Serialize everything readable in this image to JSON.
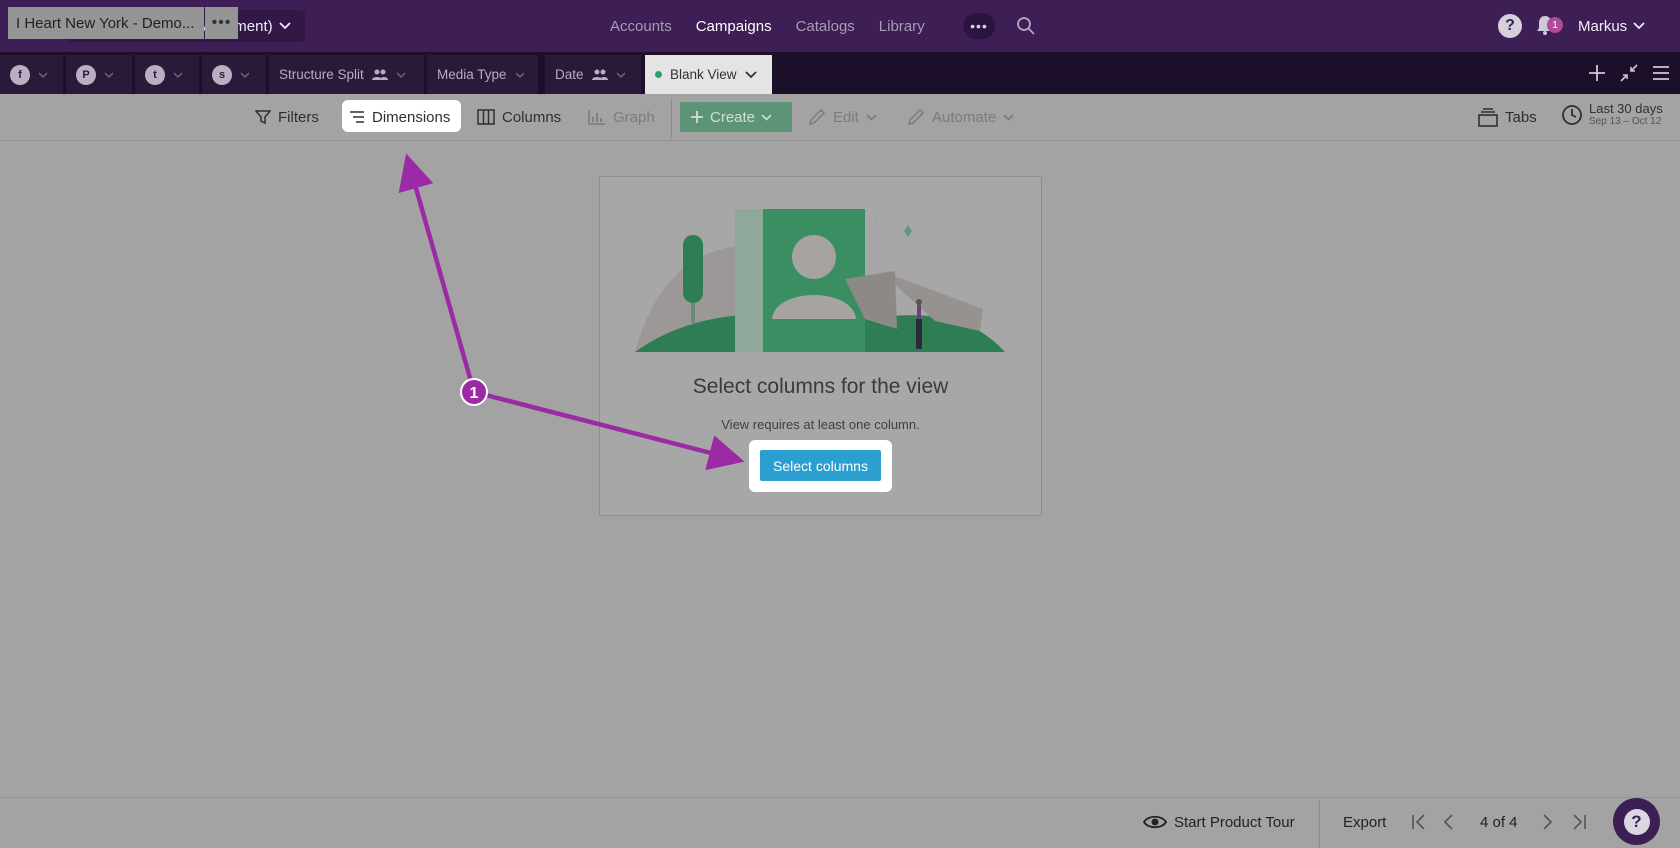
{
  "topnav": {
    "environment": "Smartly.io (Test Environment)",
    "links": [
      "Accounts",
      "Campaigns",
      "Catalogs",
      "Library"
    ],
    "active_link": "Campaigns",
    "more_label": "•••",
    "notification_count": "1",
    "user_name": "Markus"
  },
  "tabs": {
    "platforms": [
      {
        "icon": "facebook-icon",
        "glyph": "f"
      },
      {
        "icon": "pinterest-icon",
        "glyph": "P"
      },
      {
        "icon": "twitter-icon",
        "glyph": "t"
      },
      {
        "icon": "snapchat-icon",
        "glyph": "s"
      }
    ],
    "views": [
      {
        "label": "Structure Split",
        "shared": true
      },
      {
        "label": "Media Type",
        "shared": false
      },
      {
        "label": "Date",
        "shared": true
      },
      {
        "label": "Blank View",
        "shared": false,
        "active": true
      }
    ]
  },
  "toolbar": {
    "account": "I Heart New York - Demo...",
    "filters": "Filters",
    "dimensions": "Dimensions",
    "columns": "Columns",
    "graph": "Graph",
    "create": "Create",
    "edit": "Edit",
    "automate": "Automate",
    "tabs": "Tabs",
    "date_range": "Last 30 days",
    "date_sub": "Sep 13 – Oct 12"
  },
  "empty_state": {
    "title": "Select columns for the view",
    "subtitle": "View requires at least one column.",
    "button": "Select columns"
  },
  "annotation": {
    "step": "1",
    "color": "#9b2aa5"
  },
  "footer": {
    "tour": "Start Product Tour",
    "export": "Export",
    "pagination": "4 of 4"
  },
  "colors": {
    "nav_bg": "#3d1f56",
    "tab_bg": "#1c0f29",
    "create_green": "#5d9478",
    "select_button_blue": "#2b9fd0"
  }
}
